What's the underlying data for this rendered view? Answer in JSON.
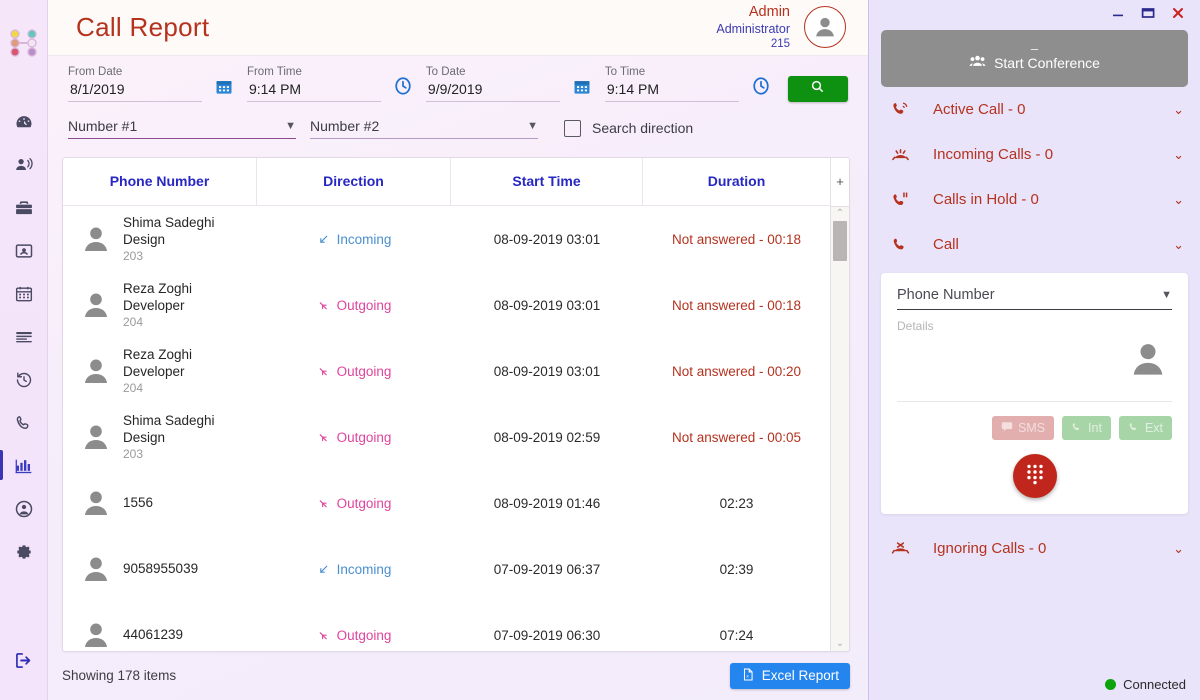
{
  "sidebar": {
    "logo_name": "network-logo",
    "items": [
      {
        "icon": "dashboard-icon",
        "active": false
      },
      {
        "icon": "announcement-icon",
        "active": false
      },
      {
        "icon": "briefcase-icon",
        "active": false
      },
      {
        "icon": "contact-card-icon",
        "active": false
      },
      {
        "icon": "calendar-icon",
        "active": false
      },
      {
        "icon": "list-icon",
        "active": false
      },
      {
        "icon": "history-icon",
        "active": false
      },
      {
        "icon": "phone-icon",
        "active": false
      },
      {
        "icon": "chart-icon",
        "active": true
      },
      {
        "icon": "account-icon",
        "active": false
      },
      {
        "icon": "settings-icon",
        "active": false
      }
    ],
    "logout_icon": "logout-icon"
  },
  "header": {
    "title": "Call Report",
    "user_name": "Admin",
    "user_role": "Administrator",
    "user_extension": "215"
  },
  "filters": {
    "from_date": {
      "label": "From Date",
      "value": "8/1/2019",
      "icon": "calendar-icon"
    },
    "from_time": {
      "label": "From Time",
      "value": "9:14 PM",
      "icon": "clock-icon"
    },
    "to_date": {
      "label": "To Date",
      "value": "9/9/2019",
      "icon": "calendar-icon"
    },
    "to_time": {
      "label": "To Time",
      "value": "9:14 PM",
      "icon": "clock-icon"
    },
    "search_icon": "search-icon",
    "number_1": "Number #1",
    "number_2": "Number #2",
    "search_direction_label": "Search direction",
    "search_direction_checked": false
  },
  "table": {
    "columns": [
      "Phone Number",
      "Direction",
      "Start Time",
      "Duration"
    ],
    "rows": [
      {
        "name": "Shima Sadeghi",
        "dept": "Design",
        "ext": "203",
        "number": "",
        "direction": "Incoming",
        "dir_type": "in",
        "start": "08-09-2019 03:01",
        "duration": "Not answered - 00:18",
        "not_answered": true
      },
      {
        "name": "Reza Zoghi",
        "dept": "Developer",
        "ext": "204",
        "number": "",
        "direction": "Outgoing",
        "dir_type": "out",
        "start": "08-09-2019 03:01",
        "duration": "Not answered - 00:18",
        "not_answered": true
      },
      {
        "name": "Reza Zoghi",
        "dept": "Developer",
        "ext": "204",
        "number": "",
        "direction": "Outgoing",
        "dir_type": "out",
        "start": "08-09-2019 03:01",
        "duration": "Not answered - 00:20",
        "not_answered": true
      },
      {
        "name": "Shima Sadeghi",
        "dept": "Design",
        "ext": "203",
        "number": "",
        "direction": "Outgoing",
        "dir_type": "out",
        "start": "08-09-2019 02:59",
        "duration": "Not answered - 00:05",
        "not_answered": true
      },
      {
        "name": "",
        "dept": "",
        "ext": "",
        "number": "1556",
        "direction": "Outgoing",
        "dir_type": "out",
        "start": "08-09-2019 01:46",
        "duration": "02:23",
        "not_answered": false
      },
      {
        "name": "",
        "dept": "",
        "ext": "",
        "number": "9058955039",
        "direction": "Incoming",
        "dir_type": "in",
        "start": "07-09-2019 06:37",
        "duration": "02:39",
        "not_answered": false
      },
      {
        "name": "",
        "dept": "",
        "ext": "",
        "number": "44061239",
        "direction": "Outgoing",
        "dir_type": "out",
        "start": "07-09-2019 06:30",
        "duration": "07:24",
        "not_answered": false
      }
    ],
    "add_column_label": "+"
  },
  "footer": {
    "showing": "Showing 178 items",
    "excel_label": "Excel Report",
    "excel_icon": "excel-icon"
  },
  "right_panel": {
    "window": {
      "minimize": "minimize-icon",
      "maximize": "maximize-icon",
      "close": "close-icon"
    },
    "conference_button": {
      "label": "Start Conference",
      "icon": "group-icon",
      "dash": "–"
    },
    "accordions": [
      {
        "label": "Active Call - 0",
        "icon": "phone-ring-icon"
      },
      {
        "label": "Incoming Calls - 0",
        "icon": "phone-incoming-icon"
      },
      {
        "label": "Calls in Hold - 0",
        "icon": "phone-hold-icon"
      },
      {
        "label": "Call",
        "icon": "phone-icon"
      }
    ],
    "call_card": {
      "phone_number_placeholder": "Phone Number",
      "details_label": "Details",
      "avatar_icon": "person-icon",
      "buttons": [
        {
          "label": "SMS",
          "icon": "message-icon",
          "kind": "sms"
        },
        {
          "label": "Int",
          "icon": "phone-icon",
          "kind": "int"
        },
        {
          "label": "Ext",
          "icon": "phone-icon",
          "kind": "ext"
        }
      ],
      "dial_icon": "dialpad-icon"
    },
    "ignoring": {
      "label": "Ignoring Calls - 0",
      "icon": "phone-missed-icon"
    },
    "status": {
      "text": "Connected",
      "color": "#0ca30c"
    }
  },
  "colors": {
    "title_red": "#b5321f",
    "header_blue": "#2727c4",
    "incoming_blue": "#4a8fd0",
    "outgoing_pink": "#e0459e",
    "search_green": "#0e9010",
    "excel_blue": "#2485ef",
    "dial_red": "#c0261b"
  }
}
